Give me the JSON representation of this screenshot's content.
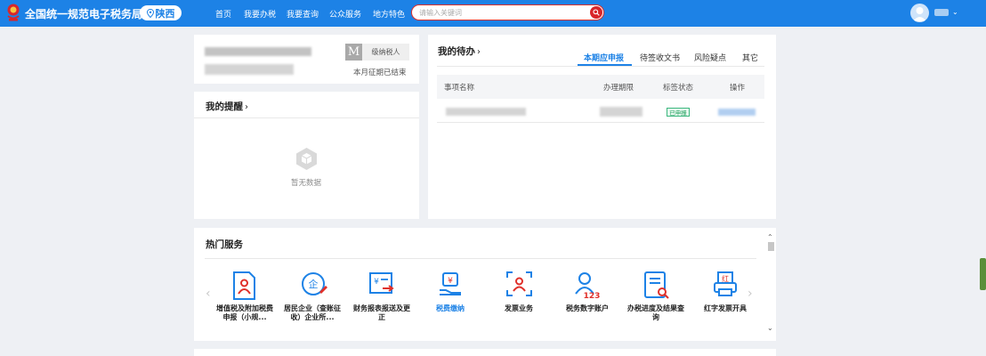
{
  "header": {
    "site_title": "全国统一规范电子税务局",
    "region": "陕西",
    "nav": [
      "首页",
      "我要办税",
      "我要查询",
      "公众服务",
      "地方特色"
    ],
    "search_placeholder": "请输入关键词"
  },
  "account": {
    "badge": "M",
    "taxpayer_type": "级纳税人",
    "period_status": "本月征期已结束"
  },
  "reminders": {
    "title": "我的提醒",
    "empty_text": "暂无数据"
  },
  "todo": {
    "title": "我的待办",
    "tabs": [
      "本期应申报",
      "待签收文书",
      "风险疑点",
      "其它"
    ],
    "active_tab": 0,
    "columns": [
      "事项名称",
      "办理期限",
      "标签状态",
      "操作"
    ],
    "rows": [
      {
        "status": "已申报"
      }
    ]
  },
  "hot_services": {
    "title": "热门服务",
    "items": [
      {
        "label": "增值税及附加税费申报（小规...",
        "icon": "document-person-icon"
      },
      {
        "label": "居民企业（查账征收）企业所...",
        "icon": "enterprise-pen-icon"
      },
      {
        "label": "财务报表报送及更正",
        "icon": "report-arrow-icon"
      },
      {
        "label": "税费缴纳",
        "icon": "payment-hand-icon",
        "active": true
      },
      {
        "label": "发票业务",
        "icon": "invoice-scan-icon"
      },
      {
        "label": "税务数字账户",
        "icon": "digital-account-icon"
      },
      {
        "label": "办税进度及结果查询",
        "icon": "progress-search-icon"
      },
      {
        "label": "红字发票开具",
        "icon": "red-invoice-printer-icon"
      }
    ]
  },
  "colors": {
    "brand_blue": "#1d82e6",
    "search_red": "#d8262a",
    "status_green": "#1fa05c"
  }
}
